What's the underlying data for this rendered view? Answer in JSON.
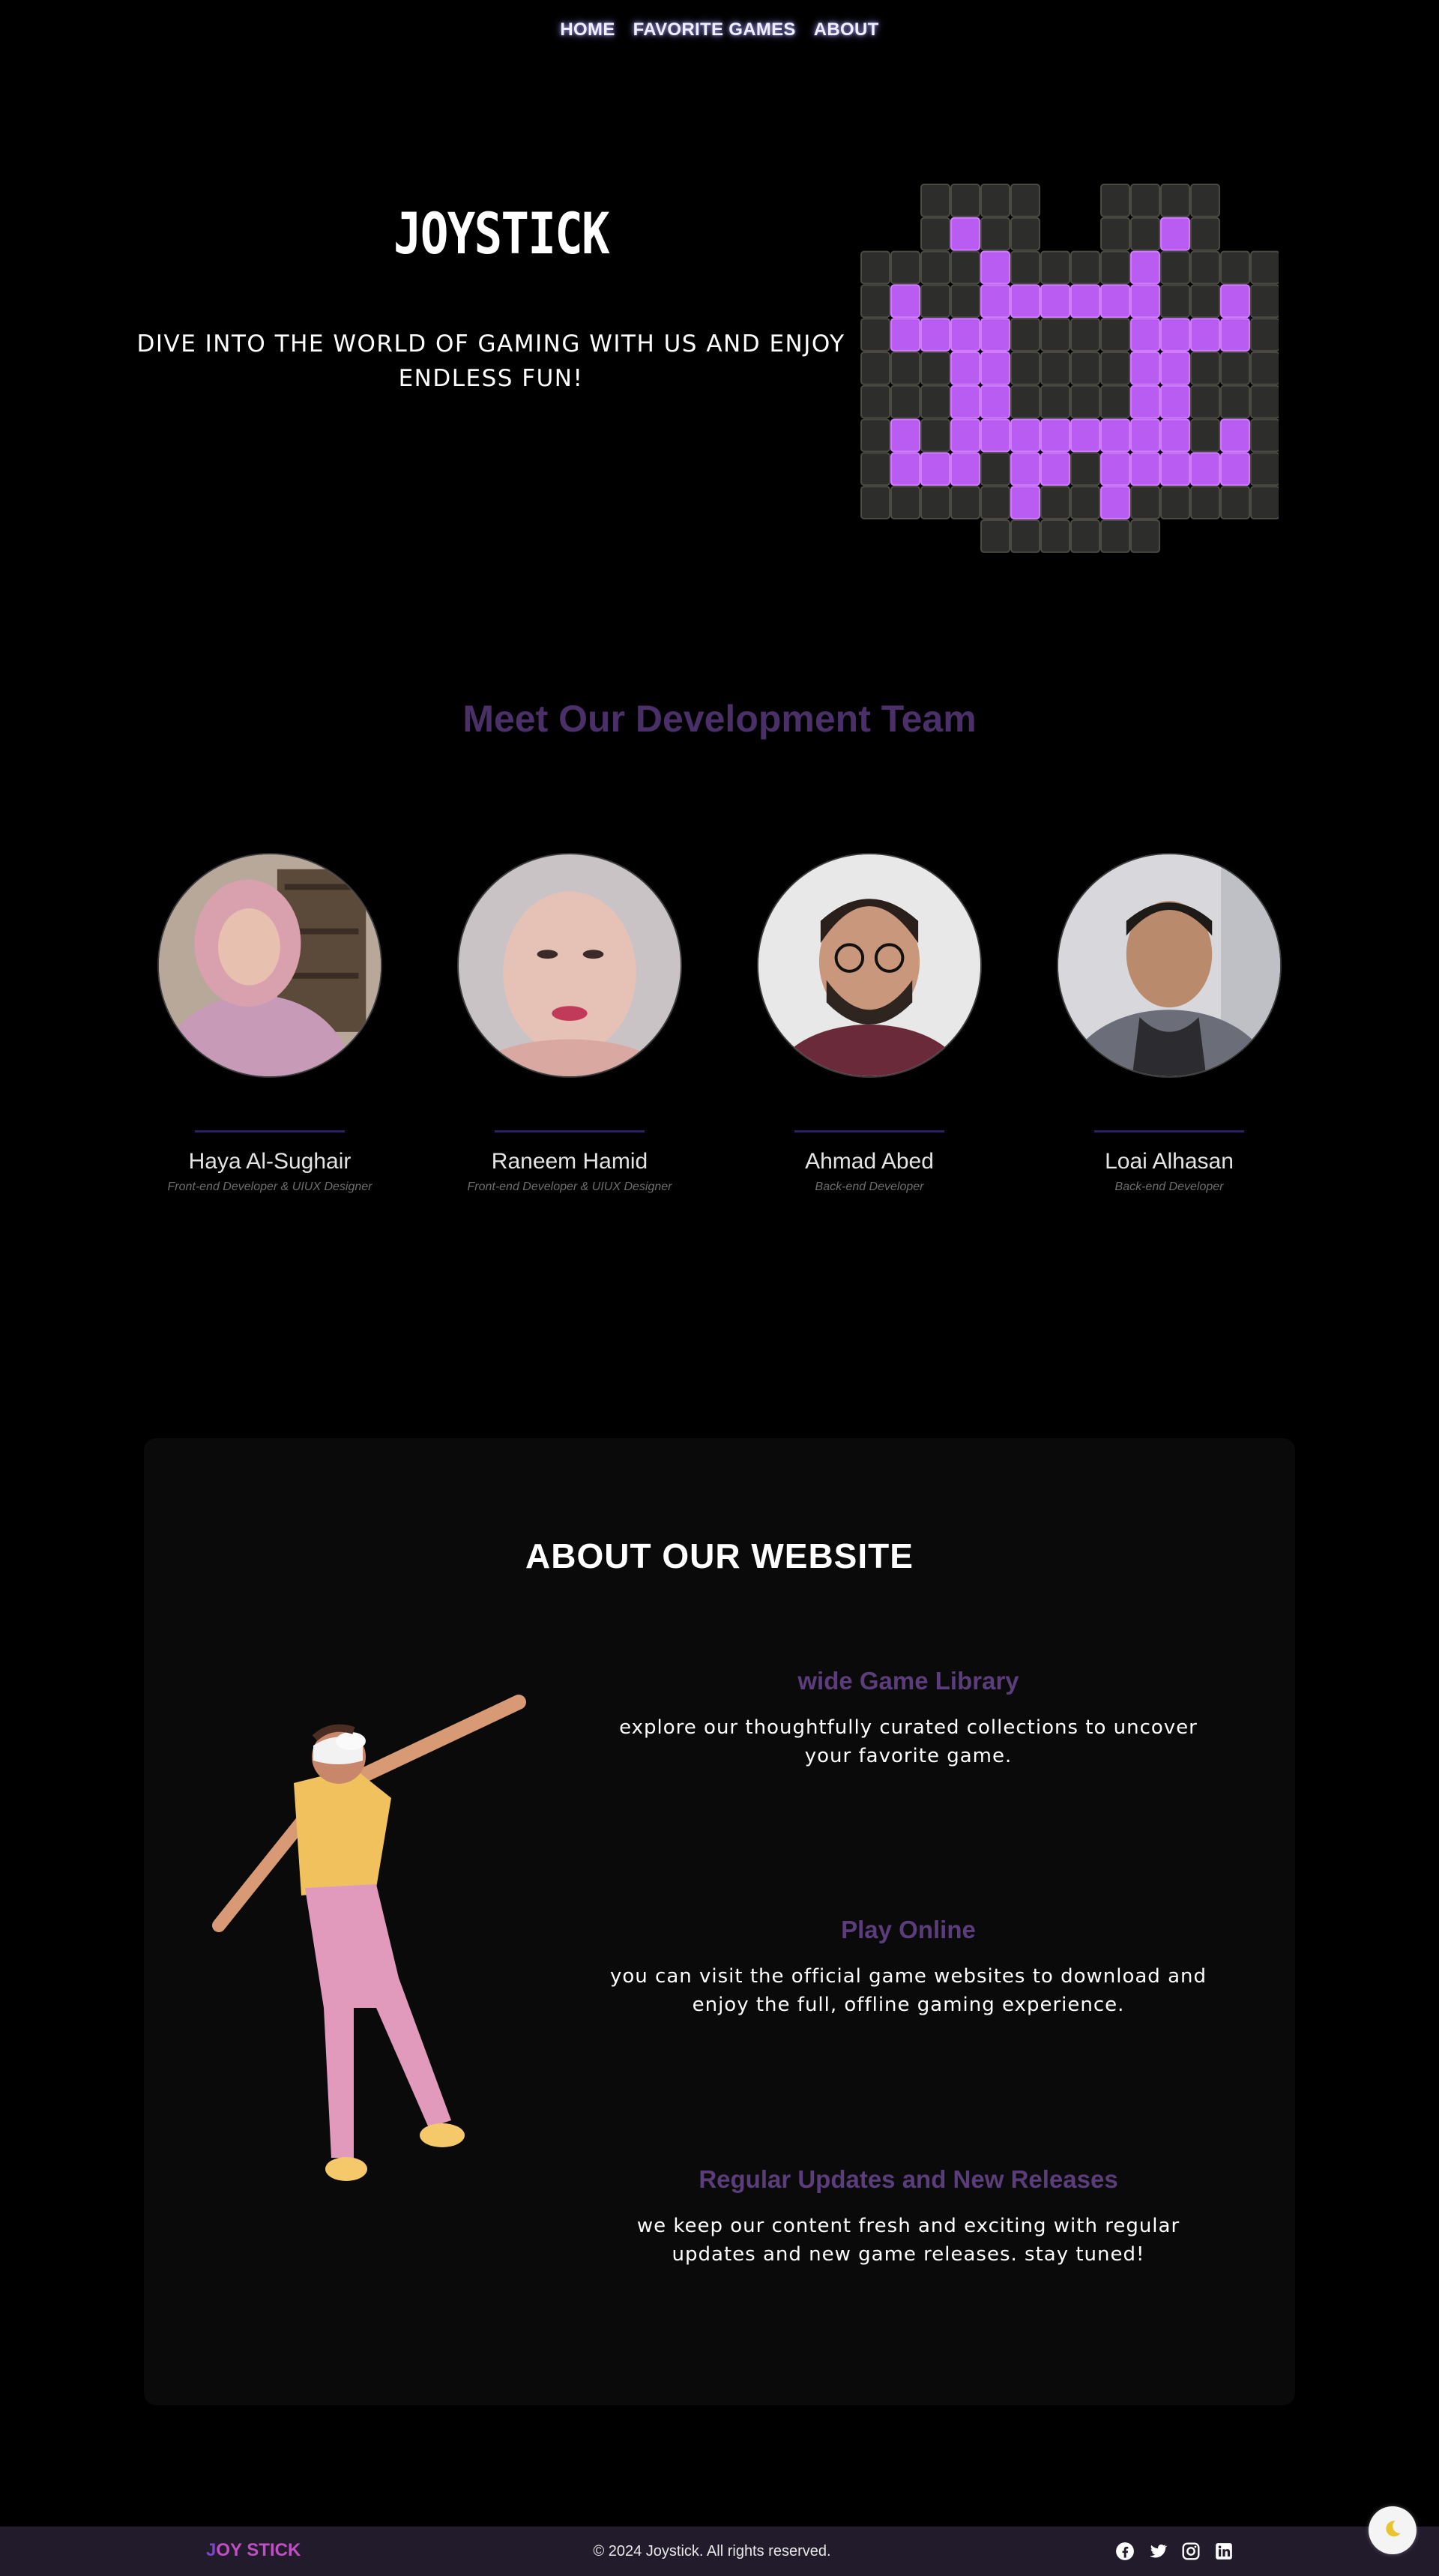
{
  "nav": {
    "items": [
      {
        "label": "HOME"
      },
      {
        "label": "FAVORITE GAMES"
      },
      {
        "label": "ABOUT"
      }
    ]
  },
  "hero": {
    "logo": "JOYSTICK",
    "tagline": "DIVE INTO THE WORLD OF GAMING WITH US AND ENJOY ENDLESS FUN!",
    "image_icon": "pixel-space-invader-icon"
  },
  "team": {
    "title": "Meet Our Development Team",
    "members": [
      {
        "name": "Haya Al-Sughair",
        "role": "Front-end Developer & UIUX Designer"
      },
      {
        "name": "Raneem Hamid",
        "role": "Front-end Developer & UIUX Designer"
      },
      {
        "name": "Ahmad Abed",
        "role": "Back-end Developer"
      },
      {
        "name": "Loai Alhasan",
        "role": "Back-end Developer"
      }
    ]
  },
  "about": {
    "title": "ABOUT OUR WEBSITE",
    "features": [
      {
        "title": "wide Game Library",
        "text": "explore our thoughtfully curated collections to uncover your favorite game."
      },
      {
        "title": "Play Online",
        "text": "you can visit the official game websites to download and enjoy the full, offline gaming experience."
      },
      {
        "title": "Regular Updates and New Releases",
        "text": "we keep our content fresh and exciting with regular updates and new game releases. stay tuned!"
      }
    ]
  },
  "footer": {
    "logo_a": "J",
    "logo_b": "OY STICK",
    "copyright": "© 2024 Joystick. All rights reserved.",
    "socials": [
      "facebook-icon",
      "twitter-icon",
      "instagram-icon",
      "linkedin-icon"
    ]
  },
  "colors": {
    "accent_purple": "#4a2f69",
    "feature_title": "#5a3d7a",
    "footer_bg": "#221b2b",
    "invader_purple": "#b95cf2"
  }
}
